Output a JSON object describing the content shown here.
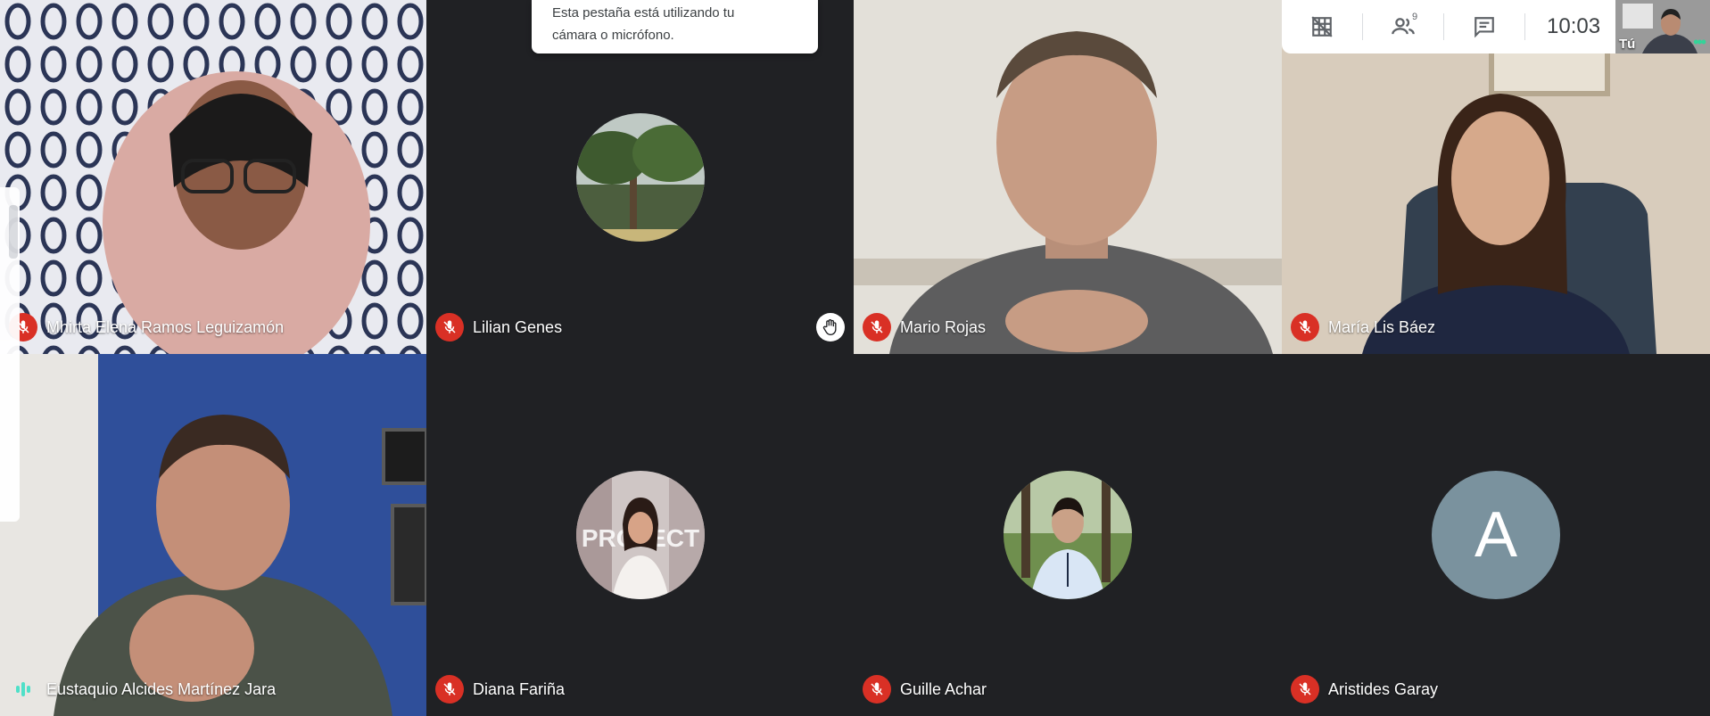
{
  "participants": [
    {
      "name": "Mhirta Elena Ramos Leguizamón",
      "muted": true
    },
    {
      "name": "Lilian Genes",
      "muted": true,
      "hand_raised": true
    },
    {
      "name": "Mario Rojas",
      "muted": true
    },
    {
      "name": "María Lis Báez",
      "muted": true
    },
    {
      "name": "Eustaquio Alcides Martínez Jara",
      "speaking": true
    },
    {
      "name": "Diana Fariña",
      "muted": true
    },
    {
      "name": "Guille Achar",
      "muted": true
    },
    {
      "name": "Aristides Garay",
      "muted": true,
      "initial": "A"
    }
  ],
  "banner": {
    "line1": "Esta pestaña está utilizando tu",
    "line2": "cámara o micrófono."
  },
  "topbar": {
    "people_count": "9",
    "clock": "10:03"
  },
  "self_view": {
    "label": "Tú"
  },
  "colors": {
    "background": "#202124",
    "muted_red": "#d93025",
    "speaking_teal": "#4fe0c8",
    "letter_avatar": "#7a929e"
  },
  "icons": [
    "mic-off-icon",
    "hand-raised-icon",
    "grid-layout-icon",
    "people-icon",
    "chat-icon",
    "more-dots-icon",
    "audio-wave-icon"
  ]
}
